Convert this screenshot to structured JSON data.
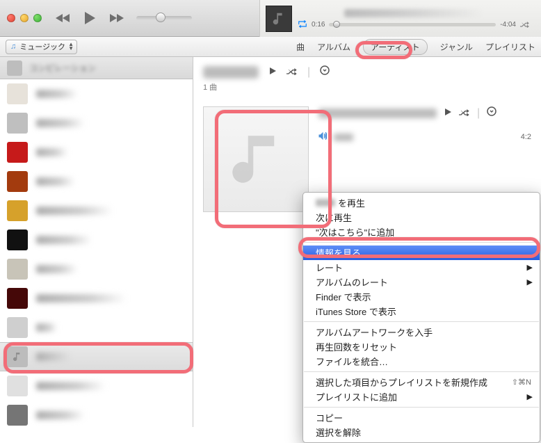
{
  "toolbar": {
    "time_elapsed": "0:16",
    "time_remaining": "-4:04"
  },
  "library_button": {
    "label": "ミュージック"
  },
  "views": {
    "song": "曲",
    "album": "アルバム",
    "artist": "アーティスト",
    "genre": "ジャンル",
    "playlist": "プレイリスト"
  },
  "content": {
    "track_count": "1 曲",
    "track_duration": "4:2"
  },
  "context_menu": {
    "play_suffix": "を再生",
    "play_next": "次に再生",
    "add_up_next": "\"次はこちら\"に追加",
    "get_info": "情報を見る",
    "rating": "レート",
    "album_rating": "アルバムのレート",
    "show_finder": "Finder で表示",
    "show_store": "iTunes Store で表示",
    "get_artwork": "アルバムアートワークを入手",
    "reset_plays": "再生回数をリセット",
    "consolidate": "ファイルを統合…",
    "new_playlist": "選択した項目からプレイリストを新規作成",
    "new_playlist_sc": "⇧⌘N",
    "add_to_playlist": "プレイリストに追加",
    "copy": "コピー",
    "deselect": "選択を解除"
  }
}
